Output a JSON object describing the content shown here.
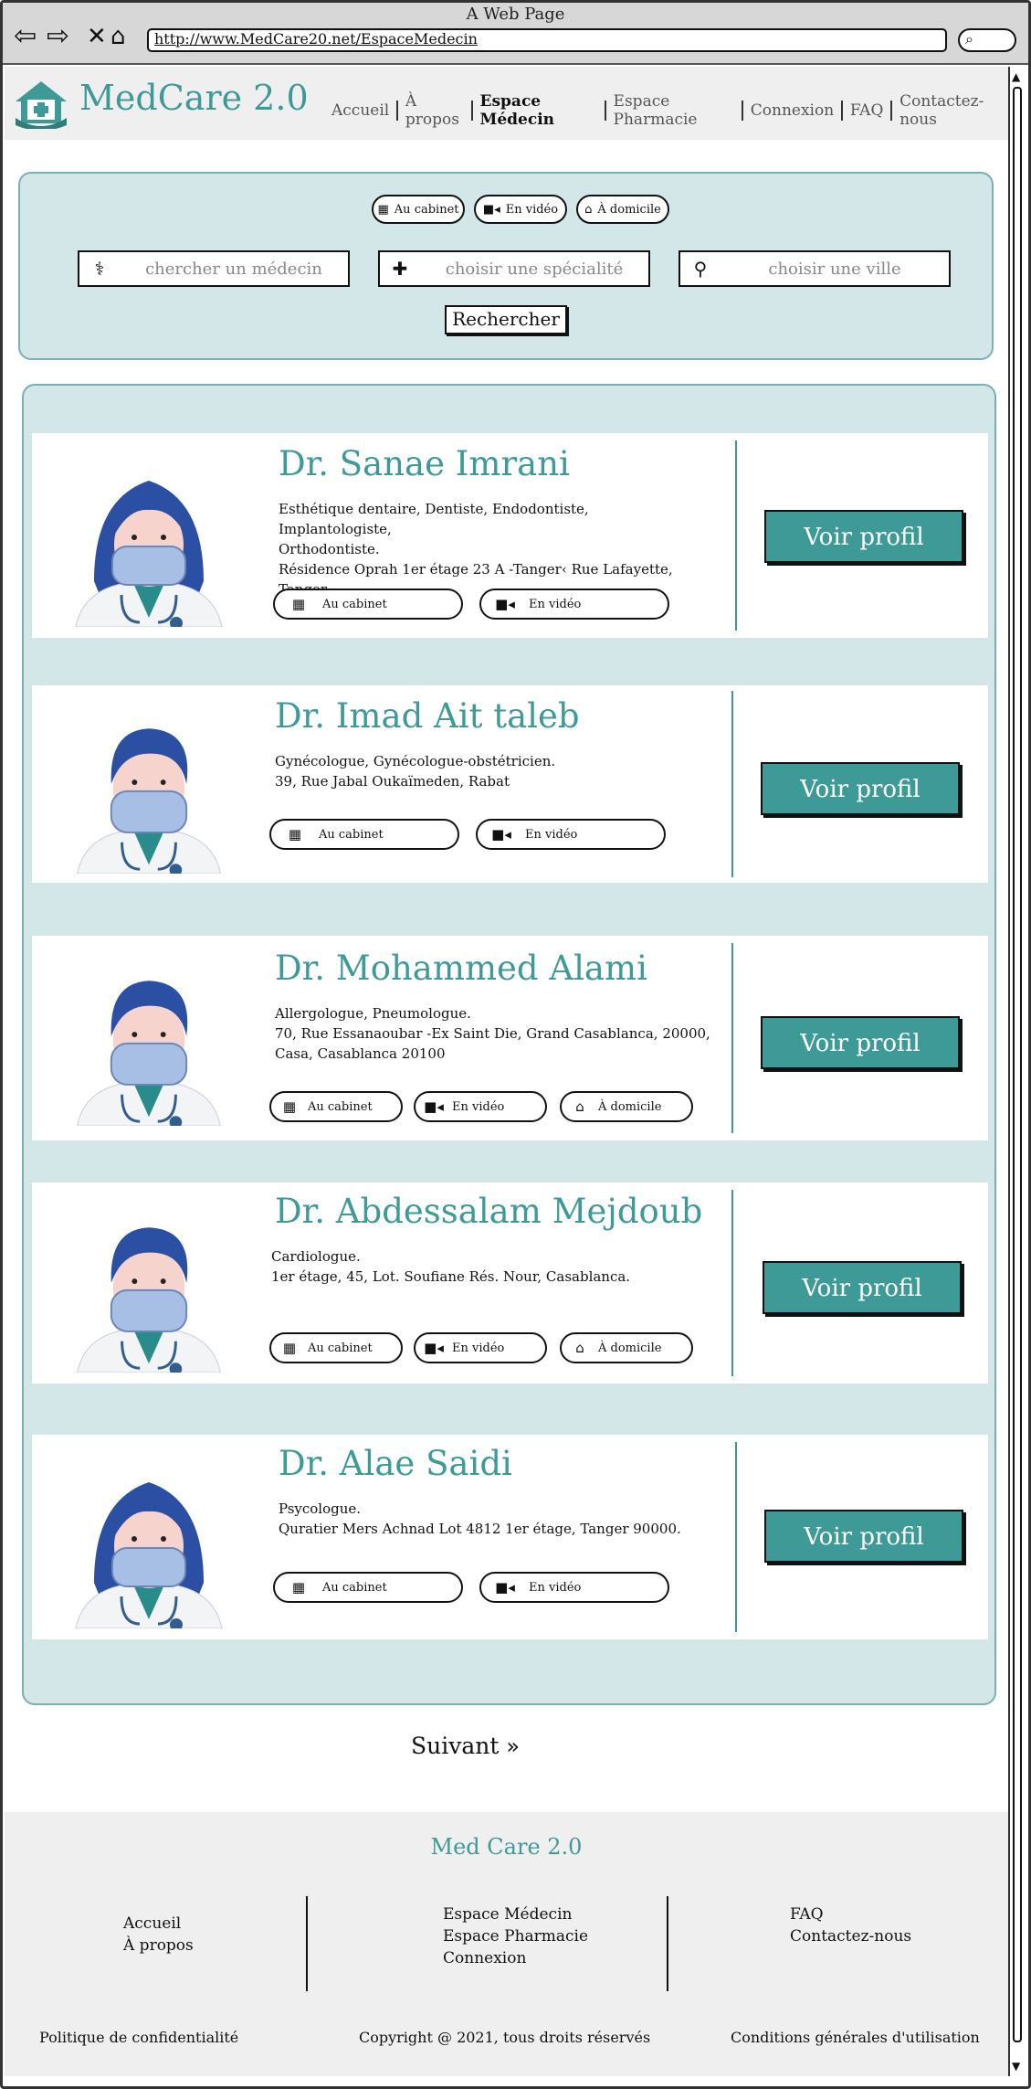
{
  "window": {
    "title": "A Web Page",
    "url": "http://www.MedCare20.net/EspaceMedecin"
  },
  "icons": {
    "back": "arrow-left-icon",
    "forward": "arrow-right-icon",
    "close": "close-icon",
    "home": "home-icon",
    "search": "search-icon",
    "building": "building-icon",
    "video": "video-camera-icon",
    "house": "house-icon",
    "doctor": "doctor-icon",
    "medkit": "medkit-icon",
    "pin": "map-pin-icon"
  },
  "colors": {
    "accent": "#3e9a97",
    "panel": "#d3e7e9",
    "panel_border": "#7ab0b4",
    "header_bg": "#efefef"
  },
  "header": {
    "logo": "MedCare 2.0",
    "nav": [
      "Accueil",
      "À propos",
      "Espace Médecin",
      "Espace Pharmacie",
      "Connexion",
      "FAQ",
      "Contactez-nous"
    ],
    "active_nav": "Espace Médecin"
  },
  "search": {
    "modes": [
      "Au cabinet",
      "En vidéo",
      "À domicile"
    ],
    "doctor_placeholder": "chercher un médecin",
    "specialty_placeholder": "choisir une spécialité",
    "city_placeholder": "choisir une ville",
    "button": "Rechercher"
  },
  "doctors": [
    {
      "name": "Dr. Sanae Imrani",
      "gender": "female",
      "line1": "Esthétique dentaire, Dentiste, Endodontiste, Implantologiste,",
      "line2": "Orthodontiste.",
      "line3": "Résidence Oprah 1er étage 23 A -Tanger‹ Rue Lafayette,",
      "line4": "Tanger",
      "modes": [
        "Au cabinet",
        "En vidéo"
      ],
      "button": "Voir profil"
    },
    {
      "name": "Dr. Imad Ait taleb",
      "gender": "male",
      "line1": "Gynécologue, Gynécologue-obstétricien.",
      "line2": "39, Rue Jabal Oukaïmeden, Rabat",
      "modes": [
        "Au cabinet",
        "En vidéo"
      ],
      "button": "Voir profil"
    },
    {
      "name": "Dr. Mohammed Alami",
      "gender": "male",
      "line1": "Allergologue, Pneumologue.",
      "line2": "70, Rue Essanaoubar -Ex Saint Die, Grand Casablanca, 20000,",
      "line3": "Casa, Casablanca 20100",
      "modes": [
        "Au cabinet",
        "En vidéo",
        "À domicile"
      ],
      "button": "Voir profil"
    },
    {
      "name": "Dr. Abdessalam Mejdoub",
      "gender": "male",
      "line1": "Cardiologue.",
      "line2": "1er étage, 45, Lot. Soufiane Rés. Nour, Casablanca.",
      "modes": [
        "Au cabinet",
        "En vidéo",
        "À domicile"
      ],
      "button": "Voir profil"
    },
    {
      "name": "Dr. Alae Saidi",
      "gender": "female",
      "line1": "Psycologue.",
      "line2": "Quratier Mers Achnad Lot 4812 1er étage, Tanger 90000.",
      "modes": [
        "Au cabinet",
        "En vidéo"
      ],
      "button": "Voir profil"
    }
  ],
  "pagination": {
    "next": "Suivant"
  },
  "footer": {
    "title": "Med Care 2.0",
    "col1": [
      "Accueil",
      "À propos"
    ],
    "col2": [
      "Espace Médecin",
      "Espace Pharmacie",
      "Connexion"
    ],
    "col3": [
      "FAQ",
      "Contactez-nous"
    ],
    "privacy": "Politique de confidentialité",
    "copyright": "Copyright @ 2021, tous droits réservés",
    "terms": "Conditions générales d'utilisation"
  }
}
